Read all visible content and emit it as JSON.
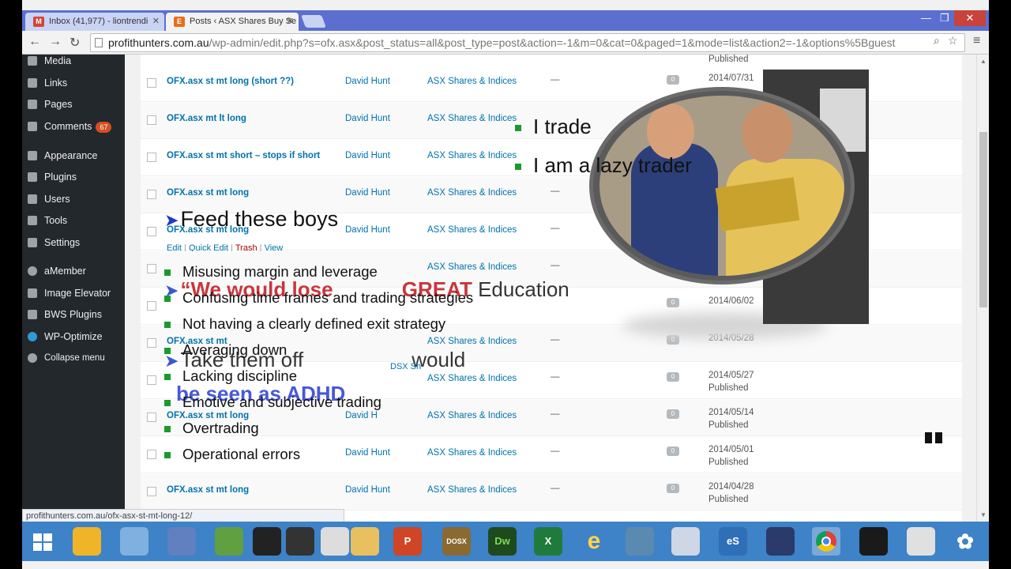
{
  "browser": {
    "tabs": [
      {
        "label": "Inbox (41,977) - liontrendi",
        "favicon": "M",
        "color": "#d44638"
      },
      {
        "label": "Posts ‹ ASX Shares Buy Se",
        "favicon": "E",
        "color": "#e66e1b"
      }
    ],
    "url_host": "profithunters.com.au",
    "url_path": "/wp-admin/edit.php?s=ofx.asx&post_status=all&post_type=post&action=-1&m=0&cat=0&paged=1&mode=list&action2=-1&options%5Bguest",
    "status_url": "profithunters.com.au/ofx-asx-st-mt-long-12/"
  },
  "sidebar": {
    "items": [
      {
        "label": "Media",
        "icon": "media-icon"
      },
      {
        "label": "Links",
        "icon": "links-icon"
      },
      {
        "label": "Pages",
        "icon": "pages-icon"
      },
      {
        "label": "Comments",
        "icon": "comments-icon",
        "badge": "67"
      },
      {
        "label": "Appearance",
        "icon": "appearance-icon"
      },
      {
        "label": "Plugins",
        "icon": "plugins-icon"
      },
      {
        "label": "Users",
        "icon": "users-icon"
      },
      {
        "label": "Tools",
        "icon": "tools-icon"
      },
      {
        "label": "Settings",
        "icon": "settings-icon"
      },
      {
        "label": "aMember",
        "icon": "gear-icon"
      },
      {
        "label": "Image Elevator",
        "icon": "image-elevator-icon"
      },
      {
        "label": "BWS Plugins",
        "icon": "bws-icon"
      },
      {
        "label": "WP-Optimize",
        "icon": "wp-optimize-icon"
      },
      {
        "label": "Collapse menu",
        "icon": "collapse-icon"
      }
    ]
  },
  "posts": {
    "top_published": "Published",
    "row_actions": {
      "edit": "Edit",
      "quick_edit": "Quick Edit",
      "trash": "Trash",
      "view": "View"
    },
    "rows": [
      {
        "title": "OFX.asx st mt long (short ??)",
        "author": "David Hunt",
        "category": "ASX Shares & Indices",
        "tags": "—",
        "comments": "0",
        "date": "2014/07/31",
        "status": ""
      },
      {
        "title": "OFX.asx mt lt long",
        "author": "David Hunt",
        "category": "ASX Shares & Indices",
        "tags": "",
        "comments": "",
        "date": "",
        "status": ""
      },
      {
        "title": "OFX.asx st mt short – stops if short",
        "author": "David Hunt",
        "category": "ASX Shares & Indices",
        "tags": "",
        "comments": "",
        "date": "",
        "status": ""
      },
      {
        "title": "OFX.asx st mt long",
        "author": "David Hunt",
        "category": "ASX Shares & Indices",
        "tags": "—",
        "comments": "",
        "date": "",
        "status": ""
      },
      {
        "title": "OFX.asx st mt long",
        "author": "David Hunt",
        "category": "ASX Shares & Indices",
        "tags": "—",
        "comments": "",
        "date": "",
        "status": ""
      },
      {
        "title": "",
        "author": "",
        "category": "ASX Shares & Indices",
        "tags": "—",
        "comments": "",
        "date": "",
        "status": ""
      },
      {
        "title": "",
        "author": "",
        "category": "",
        "tags": "",
        "comments": "0",
        "date": "2014/06/02",
        "status": ""
      },
      {
        "title": "OFX.asx st mt",
        "author": "",
        "category": "ASX Shares & Indices",
        "tags": "—",
        "comments": "0",
        "date": "2014/05/28",
        "status": ""
      },
      {
        "title": "",
        "author": "",
        "category": "ASX Shares & Indices",
        "tags": "—",
        "comments": "0",
        "date": "2014/05/27",
        "status": "Published"
      },
      {
        "title": "OFX.asx st mt long",
        "author": "David H",
        "category": "ASX Shares & Indices",
        "tags": "—",
        "comments": "0",
        "date": "2014/05/14",
        "status": "Published"
      },
      {
        "title": "",
        "author": "David Hunt",
        "category": "ASX Shares & Indices",
        "tags": "—",
        "comments": "0",
        "date": "2014/05/01",
        "status": "Published"
      },
      {
        "title": "OFX.asx st mt long",
        "author": "David Hunt",
        "category": "ASX Shares & Indices",
        "tags": "—",
        "comments": "0",
        "date": "2014/04/28",
        "status": "Published"
      }
    ]
  },
  "overlay": {
    "trade_bullets": [
      "I trade",
      "I am a lazy trader"
    ],
    "feed_heading": "Feed these boys",
    "errors": [
      "Misusing margin and leverage",
      "Confusing time frames and trading strategies",
      "Not having a clearly defined exit strategy",
      "Averaging down",
      "Lacking discipline",
      "Emotive and subjective trading",
      "Overtrading",
      "Operational errors"
    ],
    "ghost_quote": "“We would lose",
    "ghost_great": "GREAT",
    "ghost_education": "Education",
    "ghost_take": "Take them off",
    "ghost_would": "would",
    "ghost_adhd": "be seen as ADHD",
    "ghost_dsx": "DSX Sh"
  },
  "taskbar": {
    "icons": [
      {
        "name": "start-icon",
        "label": ""
      },
      {
        "name": "powerpoint-icon",
        "label": "P"
      },
      {
        "name": "dosx-icon",
        "label": "DOSX"
      },
      {
        "name": "dreamweaver-icon",
        "label": "Dw"
      },
      {
        "name": "excel-icon",
        "label": "X"
      },
      {
        "name": "ie-icon",
        "label": "e"
      },
      {
        "name": "esignal-icon",
        "label": "eS"
      },
      {
        "name": "chrome-icon",
        "label": ""
      }
    ]
  },
  "colors": {
    "wp_sidebar": "#23282d",
    "wp_link": "#0073aa",
    "taskbar": "#3e82c7",
    "bullet": "#1a9a2c"
  }
}
